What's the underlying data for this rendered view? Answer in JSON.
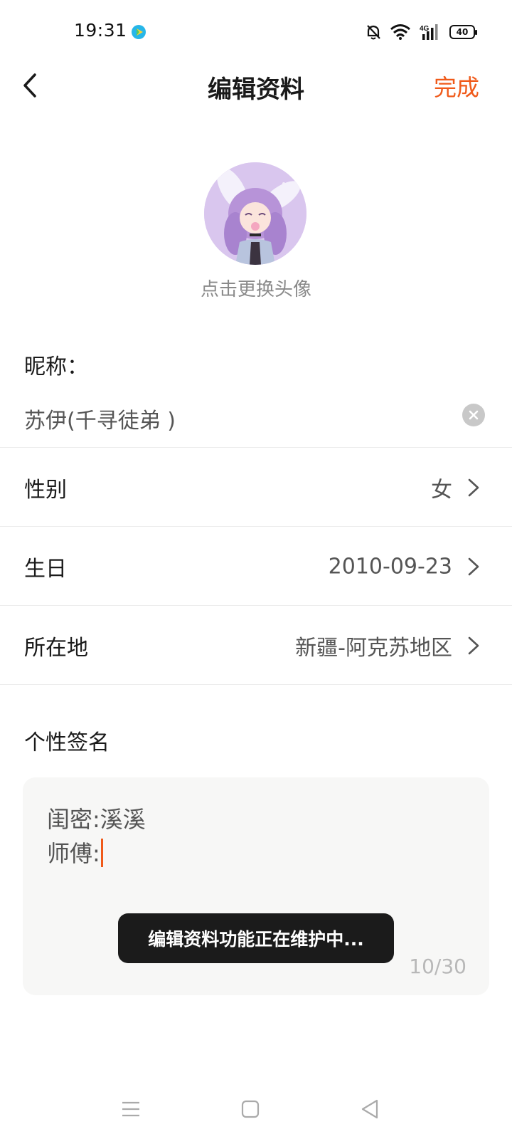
{
  "status_bar": {
    "time": "19:31",
    "battery": "40",
    "network": "4G"
  },
  "nav": {
    "title": "编辑资料",
    "done_label": "完成"
  },
  "avatar": {
    "hint": "点击更换头像"
  },
  "nickname": {
    "label": "昵称：",
    "value": "苏伊(千寻徒弟 )"
  },
  "rows": [
    {
      "label": "性别",
      "value": "女"
    },
    {
      "label": "生日",
      "value": "2010-09-23"
    },
    {
      "label": "所在地",
      "value": "新疆-阿克苏地区"
    }
  ],
  "bio": {
    "label": "个性签名",
    "line1": "闺密:溪溪",
    "line2": "师傅:",
    "counter": "10/30"
  },
  "toast": {
    "message": "编辑资料功能正在维护中..."
  },
  "colors": {
    "accent": "#f05a1a",
    "text_primary": "#1a1a1a",
    "text_secondary": "#555555",
    "hint": "#8a8a8a"
  },
  "icons": {
    "back": "chevron-left-icon",
    "clear": "clear-circle-icon",
    "chevron": "chevron-right-icon",
    "status": [
      "mute-bell-icon",
      "wifi-icon",
      "signal-icon",
      "battery-icon"
    ],
    "system_nav": [
      "menu-icon",
      "home-square-icon",
      "back-triangle-icon"
    ]
  }
}
